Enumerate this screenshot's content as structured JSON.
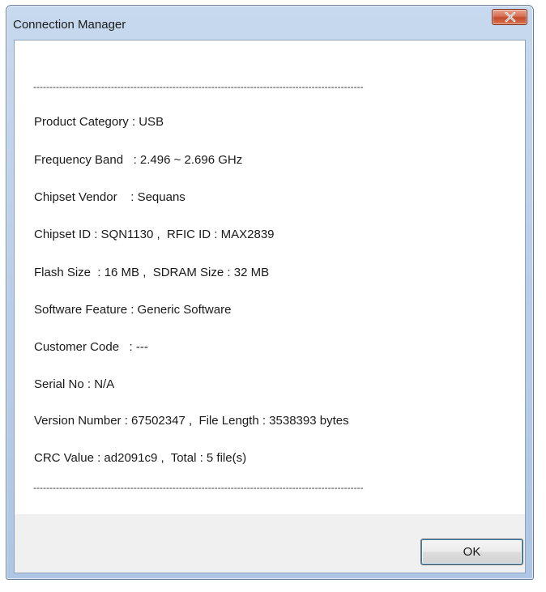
{
  "window": {
    "title": "Connection Manager"
  },
  "content": {
    "separator": "------------------------------------------------------------------------------------------------------",
    "lines": [
      "Product Category : USB",
      "Frequency Band   : 2.496 ~ 2.696 GHz",
      "Chipset Vendor    : Sequans",
      "Chipset ID : SQN1130 ,  RFIC ID : MAX2839",
      "Flash Size  : 16 MB ,  SDRAM Size : 32 MB",
      "Software Feature : Generic Software",
      "Customer Code   : ---",
      "Serial No : N/A",
      "Version Number : 67502347 ,  File Length : 3538393 bytes",
      "CRC Value : ad2091c9 ,  Total : 5 file(s)"
    ]
  },
  "footer": {
    "ok_label": "OK"
  },
  "icons": {
    "close": "close-icon"
  },
  "colors": {
    "titlebar": "#b9cee8",
    "close_button": "#c44a2a",
    "footer": "#f0f0f0"
  }
}
